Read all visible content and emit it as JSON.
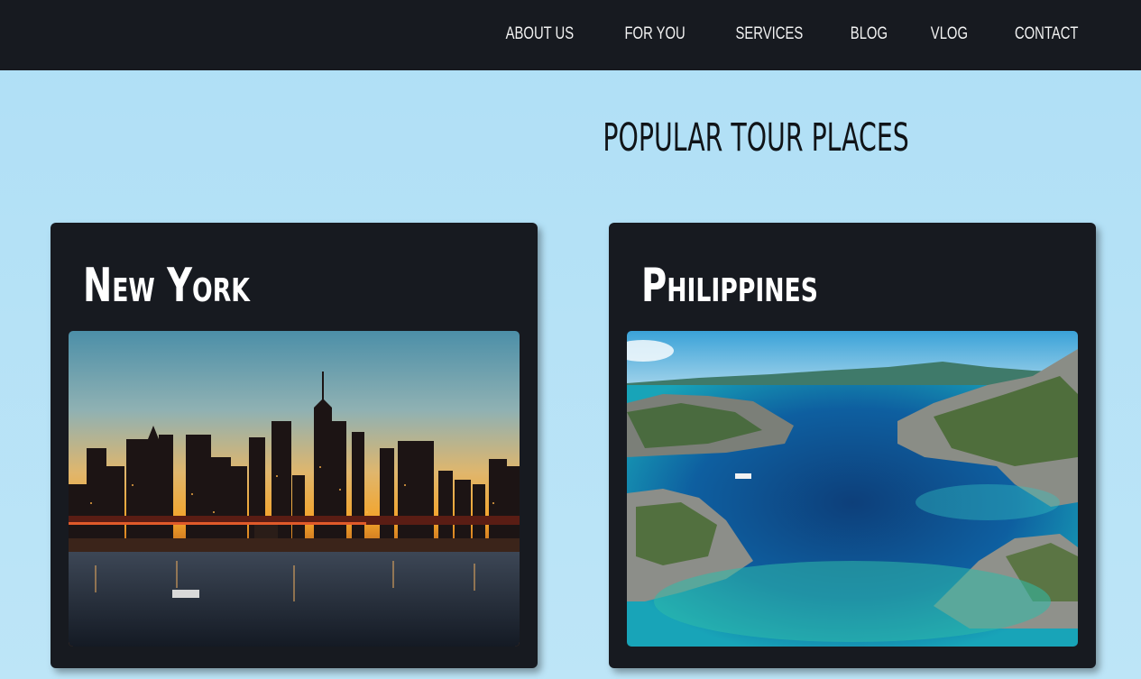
{
  "nav": {
    "items": [
      "ABOUT US",
      "FOR YOU",
      "SERVICES",
      "BLOG",
      "VLOG",
      "CONTACT"
    ]
  },
  "section": {
    "title": "POPULAR TOUR PLACES"
  },
  "cards": [
    {
      "title": "New York",
      "image": "new-york-skyline-night"
    },
    {
      "title": "Philippines",
      "image": "philippines-islands-lagoon"
    }
  ],
  "colors": {
    "header_bg": "#171a20",
    "page_bg": "#afdff6",
    "card_bg": "#171a20"
  }
}
